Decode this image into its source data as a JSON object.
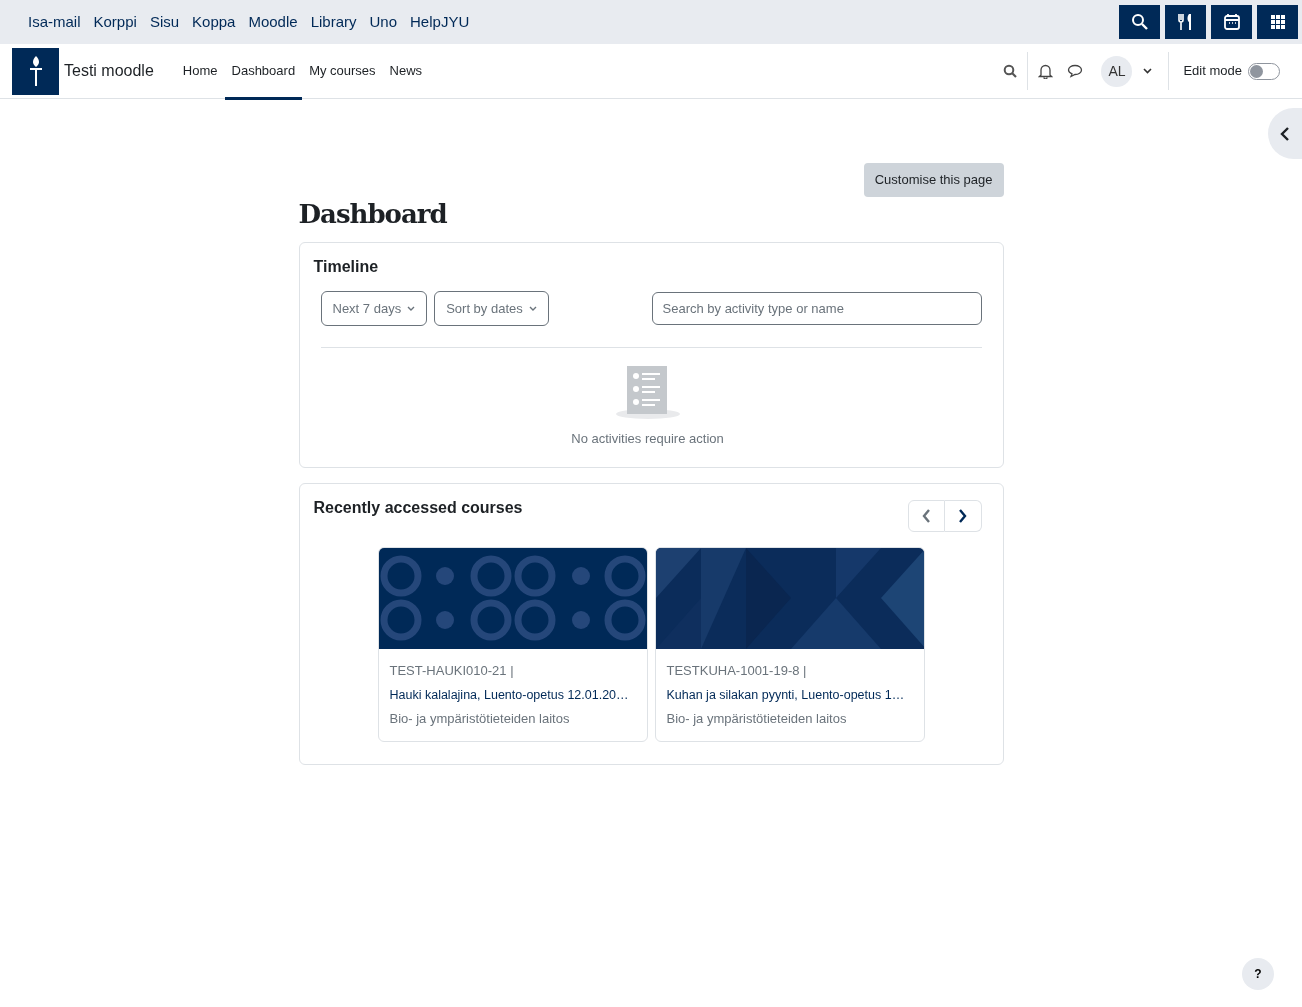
{
  "top_links": [
    "Isa-mail",
    "Korppi",
    "Sisu",
    "Koppa",
    "Moodle",
    "Library",
    "Uno",
    "HelpJYU"
  ],
  "site_name": "Testi moodle",
  "nav": [
    {
      "label": "Home",
      "selected": false
    },
    {
      "label": "Dashboard",
      "selected": true
    },
    {
      "label": "My courses",
      "selected": false
    },
    {
      "label": "News",
      "selected": false
    }
  ],
  "user_initials": "AL",
  "edit_mode": {
    "label": "Edit mode",
    "on": false
  },
  "customise_button": "Customise this page",
  "page_title": "Dashboard",
  "timeline": {
    "title": "Timeline",
    "filters": [
      "Next 7 days",
      "Sort by dates"
    ],
    "search": {
      "placeholder": "Search by activity type or name"
    },
    "empty_text": "No activities require action"
  },
  "recent": {
    "title": "Recently accessed courses",
    "prev_disabled": true,
    "next_disabled": false,
    "courses": [
      {
        "kind": "circles",
        "code": "TEST-HAUKI010-21 |",
        "name": "Hauki kalalajina, Luento-opetus 12.01.20…",
        "department": "Bio- ja ympäristötieteiden laitos"
      },
      {
        "kind": "triangles",
        "code": "TESTKUHA-1001-19-8 |",
        "name": "Kuhan ja silakan pyynti, Luento-opetus 1…",
        "department": "Bio- ja ympäristötieteiden laitos"
      }
    ]
  },
  "help_button": "?"
}
